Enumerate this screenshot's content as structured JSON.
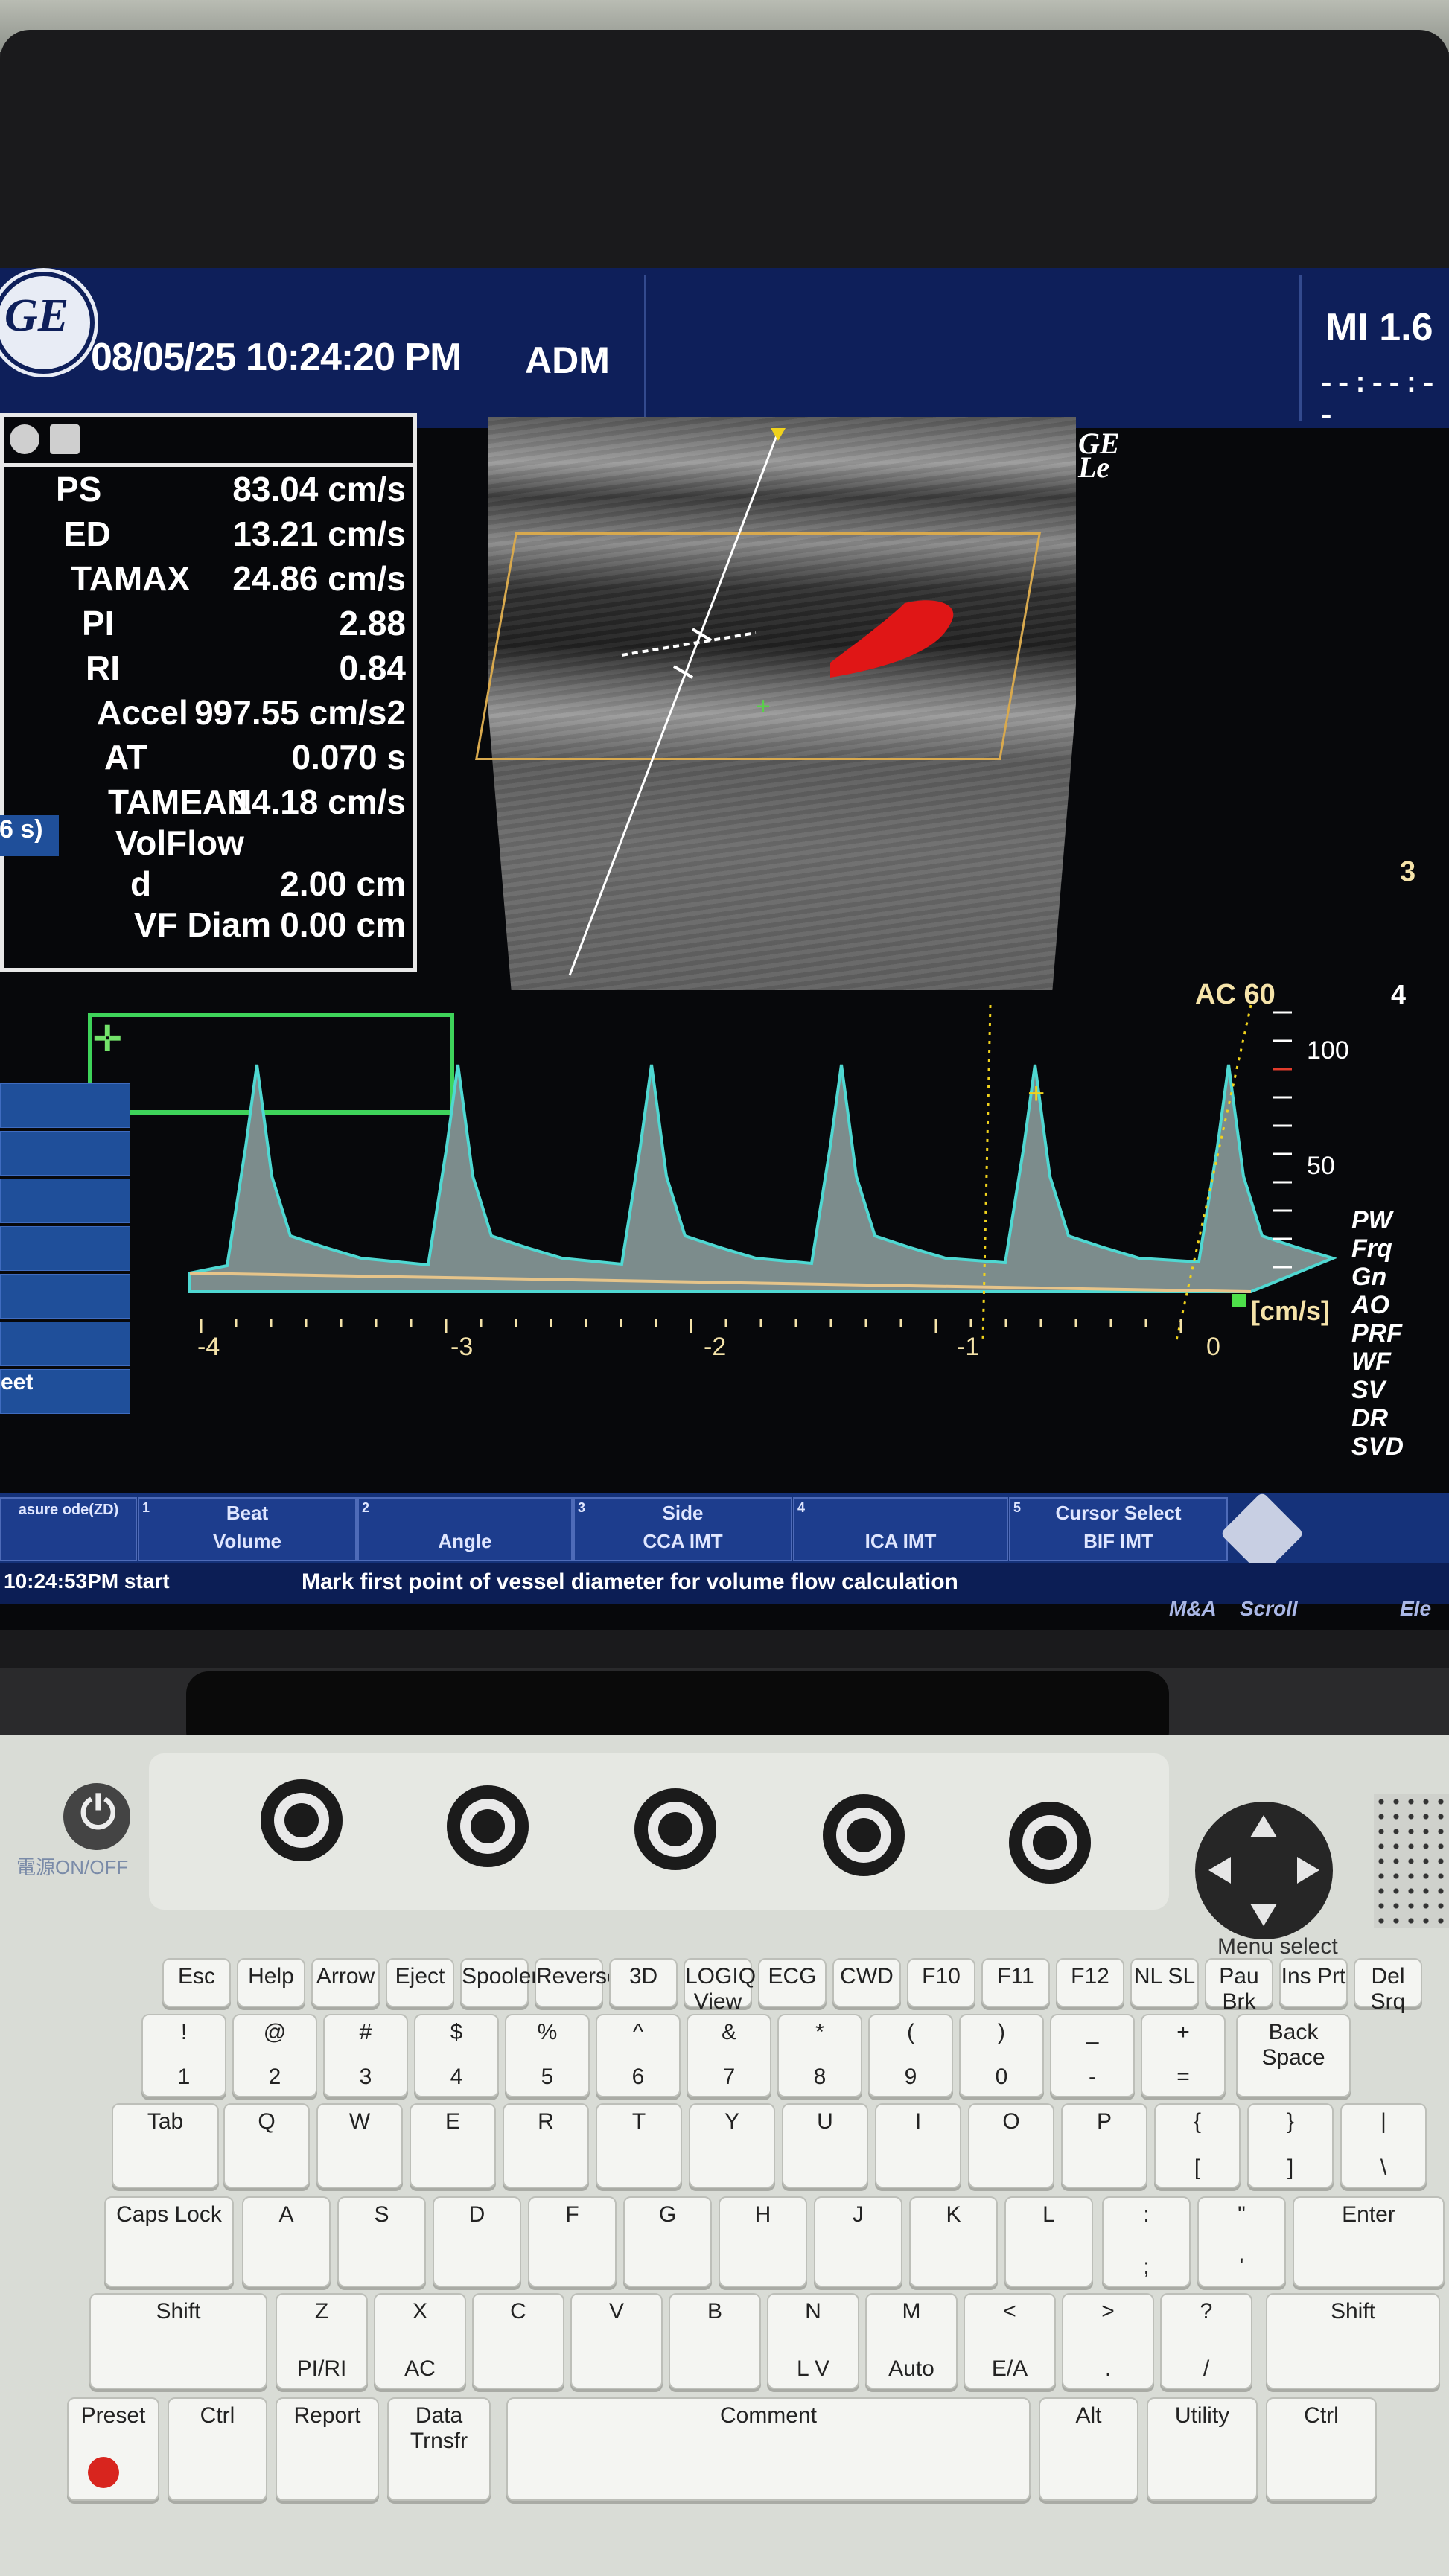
{
  "top_bar": {
    "datetime": "08/05/25 10:24:20 PM",
    "operator": "ADM",
    "mi": "MI 1.6",
    "tis": "--:--:--",
    "logo": "GE"
  },
  "measurements": [
    {
      "label": "PS",
      "value": "83.04 cm/s"
    },
    {
      "label": "ED",
      "value": "13.21 cm/s"
    },
    {
      "label": "TAMAX",
      "value": "24.86 cm/s"
    },
    {
      "label": "PI",
      "value": "2.88"
    },
    {
      "label": "RI",
      "value": "0.84"
    },
    {
      "label": "Accel",
      "value": "997.55 cm/s2"
    },
    {
      "label": "AT",
      "value": "0.070 s"
    },
    {
      "label": "TAMEAN",
      "value": "14.18 cm/s"
    },
    {
      "label": "VolFlow",
      "value": ""
    },
    {
      "label": "d",
      "value": "2.00 cm"
    },
    {
      "label": "VF Diam",
      "value": "0.00 cm"
    }
  ],
  "image_marker": "GE\nLe",
  "spectrum": {
    "angle_label": "AC 60",
    "unit": "[cm/s]",
    "velocity_ticks": [
      "100",
      "50"
    ],
    "time_ticks": [
      "-4",
      "-3",
      "-2",
      "-1",
      "0"
    ]
  },
  "right_scale": [
    "3",
    "4"
  ],
  "params": [
    "PW",
    "Frq",
    "Gn",
    "AO",
    "PRF",
    "WF",
    "SV",
    "DR",
    "SVD"
  ],
  "left_menu": {
    "time_fragment": "6 s)",
    "items": [
      "",
      "",
      "",
      "",
      "",
      "",
      "eet"
    ]
  },
  "soft_menu": [
    {
      "num": "1",
      "top": "Beat",
      "bottom": "Volume"
    },
    {
      "num": "2",
      "top": "",
      "bottom": "Angle"
    },
    {
      "num": "3",
      "top": "Side",
      "bottom": "CCA IMT"
    },
    {
      "num": "4",
      "top": "",
      "bottom": "ICA IMT"
    },
    {
      "num": "5",
      "top": "Cursor Select",
      "bottom": "BIF IMT"
    }
  ],
  "soft_menu_left": "asure ode(ZD)",
  "status": {
    "time": "10:24:53PM",
    "start": "start",
    "message": "Mark first point of vessel diameter for volume flow calculation",
    "right": [
      "M&A",
      "Scroll",
      "Ele"
    ]
  },
  "console": {
    "power_label": "電源ON/OFF",
    "menu_select": "Menu select"
  },
  "keys": {
    "fn_row": [
      "Esc",
      "Help",
      "Arrow",
      "Eject",
      "Spooler",
      "Reverse",
      "3D",
      "LOGIQ View",
      "ECG",
      "CWD",
      "F10",
      "F11",
      "F12",
      "NL SL",
      "Pau Brk",
      "Ins Prt",
      "Del Srq"
    ],
    "num_row": [
      [
        "!",
        "1"
      ],
      [
        "@",
        "2"
      ],
      [
        "#",
        "3"
      ],
      [
        "$",
        "4"
      ],
      [
        "%",
        "5"
      ],
      [
        "^",
        "6"
      ],
      [
        "&",
        "7"
      ],
      [
        "*",
        "8"
      ],
      [
        "(",
        "9"
      ],
      [
        ")",
        "0"
      ],
      [
        "_",
        "-"
      ],
      [
        "+",
        "="
      ]
    ],
    "backspace": "Back Space",
    "tab": "Tab",
    "q_row": [
      "Q",
      "W",
      "E",
      "R",
      "T",
      "Y",
      "U",
      "I",
      "O",
      "P"
    ],
    "brackets": [
      [
        "{",
        "["
      ],
      [
        "}",
        "]"
      ],
      [
        "|",
        "\\"
      ]
    ],
    "caps": "Caps Lock",
    "a_row": [
      "A",
      "S",
      "D",
      "F",
      "G",
      "H",
      "J",
      "K",
      "L"
    ],
    "semi": [
      ":",
      ";"
    ],
    "quote": [
      "\"",
      "'"
    ],
    "enter": "Enter",
    "shift": "Shift",
    "z_row": [
      [
        "Z",
        "PI/RI"
      ],
      [
        "X",
        "AC"
      ],
      [
        "C",
        ""
      ],
      [
        "V",
        ""
      ],
      [
        "B",
        ""
      ],
      [
        "N",
        "L V"
      ],
      [
        "M",
        "Auto"
      ],
      [
        "<",
        "E/A"
      ],
      [
        ">",
        "."
      ],
      [
        "?",
        "/"
      ]
    ],
    "bottom_row": [
      "Preset",
      "Ctrl",
      "Report",
      "Data Trnsfr",
      "Comment",
      "Alt",
      "Utility",
      "Ctrl"
    ]
  }
}
